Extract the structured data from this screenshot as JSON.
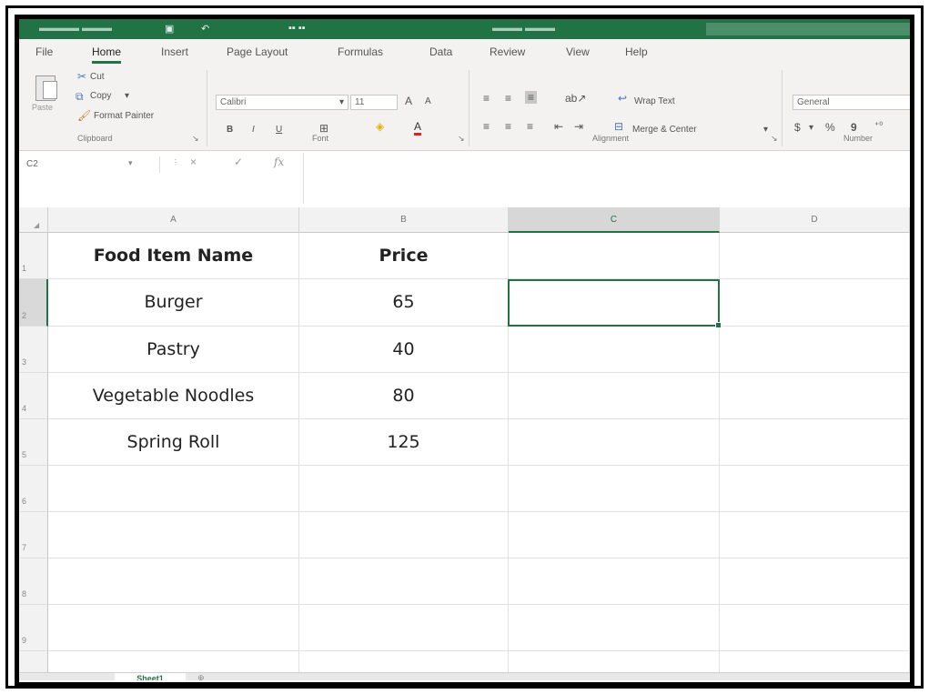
{
  "app": {
    "accent_color": "#217346"
  },
  "ribbon": {
    "tabs": [
      "File",
      "Home",
      "Insert",
      "Page Layout",
      "Formulas",
      "Data",
      "Review",
      "View",
      "Help"
    ],
    "active_tab": "Home",
    "clipboard": {
      "paste_label": "Paste",
      "cut_label": "Cut",
      "copy_label": "Copy",
      "format_painter_label": "Format Painter",
      "group_label": "Clipboard"
    },
    "font": {
      "font_name": "Calibri",
      "font_size": "11",
      "grow_label": "A",
      "shrink_label": "A",
      "bold_label": "B",
      "italic_label": "I",
      "underline_label": "U",
      "font_color_label": "A",
      "group_label": "Font"
    },
    "alignment": {
      "wrap_text_label": "Wrap Text",
      "merge_center_label": "Merge & Center",
      "group_label": "Alignment"
    },
    "number": {
      "format_value": "General",
      "currency_label": "$",
      "percent_label": "%",
      "comma_label": "9",
      "group_label": "Number"
    }
  },
  "formula_bar": {
    "name_box_value": "C2",
    "cancel_icon": "×",
    "enter_icon": "✓",
    "fx_label": "fx",
    "formula_value": ""
  },
  "sheet": {
    "columns": [
      "A",
      "B",
      "C",
      "D"
    ],
    "selected_column": "C",
    "rows": [
      "1",
      "2",
      "3",
      "4",
      "5",
      "6",
      "7",
      "8",
      "9"
    ],
    "selected_row": "2",
    "active_cell": "C2",
    "data": [
      [
        "Food Item Name",
        "Price"
      ],
      [
        "Burger",
        "65"
      ],
      [
        "Pastry",
        "40"
      ],
      [
        "Vegetable Noodles",
        "80"
      ],
      [
        "Spring Roll",
        "125"
      ]
    ],
    "header_row_bold": true,
    "tab_name": "Sheet1"
  }
}
